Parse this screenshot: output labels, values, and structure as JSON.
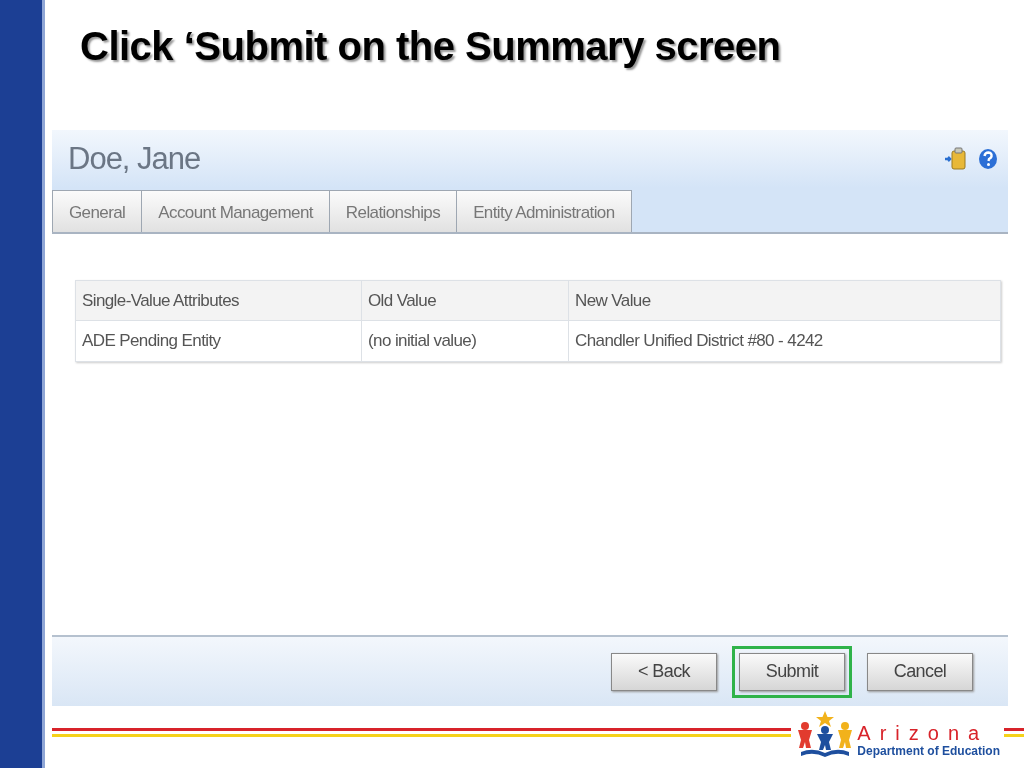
{
  "slide_title": "Click ‘Submit on the Summary screen",
  "window": {
    "title": "Doe, Jane"
  },
  "tabs": [
    {
      "label": "General",
      "selected": false
    },
    {
      "label": "Account Management",
      "selected": false
    },
    {
      "label": "Relationships",
      "selected": false
    },
    {
      "label": "Entity Administration",
      "selected": false
    }
  ],
  "table": {
    "columns": [
      "Single-Value Attributes",
      "Old Value",
      "New Value"
    ],
    "rows": [
      [
        "ADE Pending Entity",
        "(no initial value)",
        "Chandler Unified District #80 - 4242"
      ]
    ]
  },
  "buttons": [
    {
      "label": "< Back",
      "highlighted": false
    },
    {
      "label": "Submit",
      "highlighted": true
    },
    {
      "label": "Cancel",
      "highlighted": false
    }
  ],
  "logo": {
    "name": "Arizona",
    "subtitle": "Department of Education"
  }
}
